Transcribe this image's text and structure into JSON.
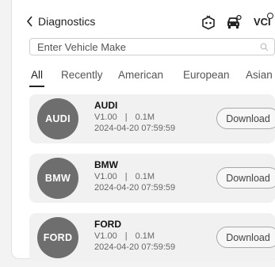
{
  "header": {
    "back_label": "Diagnostics",
    "vci_label": "VCI"
  },
  "search": {
    "placeholder": "Enter Vehicle Make",
    "value": ""
  },
  "tabs": [
    {
      "label": "All",
      "active": true
    },
    {
      "label": "Recently",
      "active": false
    },
    {
      "label": "American",
      "active": false
    },
    {
      "label": "European",
      "active": false
    },
    {
      "label": "Asian",
      "active": false
    }
  ],
  "vehicles": [
    {
      "logo_text": "AUDI",
      "name": "AUDI",
      "version": "V1.00",
      "separator": "|",
      "size": "0.1M",
      "date": "2024-04-20 07:59:59",
      "action_label": "Download"
    },
    {
      "logo_text": "BMW",
      "name": "BMW",
      "version": "V1.00",
      "separator": "|",
      "size": "0.1M",
      "date": "2024-04-20 07:59:59",
      "action_label": "Download"
    },
    {
      "logo_text": "FORD",
      "name": "FORD",
      "version": "V1.00",
      "separator": "|",
      "size": "0.1M",
      "date": "2024-04-20 07:59:59",
      "action_label": "Download"
    }
  ],
  "icons": {
    "back": "chevron-left-icon",
    "bot": "robot-icon",
    "car": "car-icon",
    "search": "search-icon"
  },
  "colors": {
    "logo_bg": "#6e6e6e",
    "card_bg": "#f1f1f1",
    "active_tab_underline": "#222222"
  }
}
